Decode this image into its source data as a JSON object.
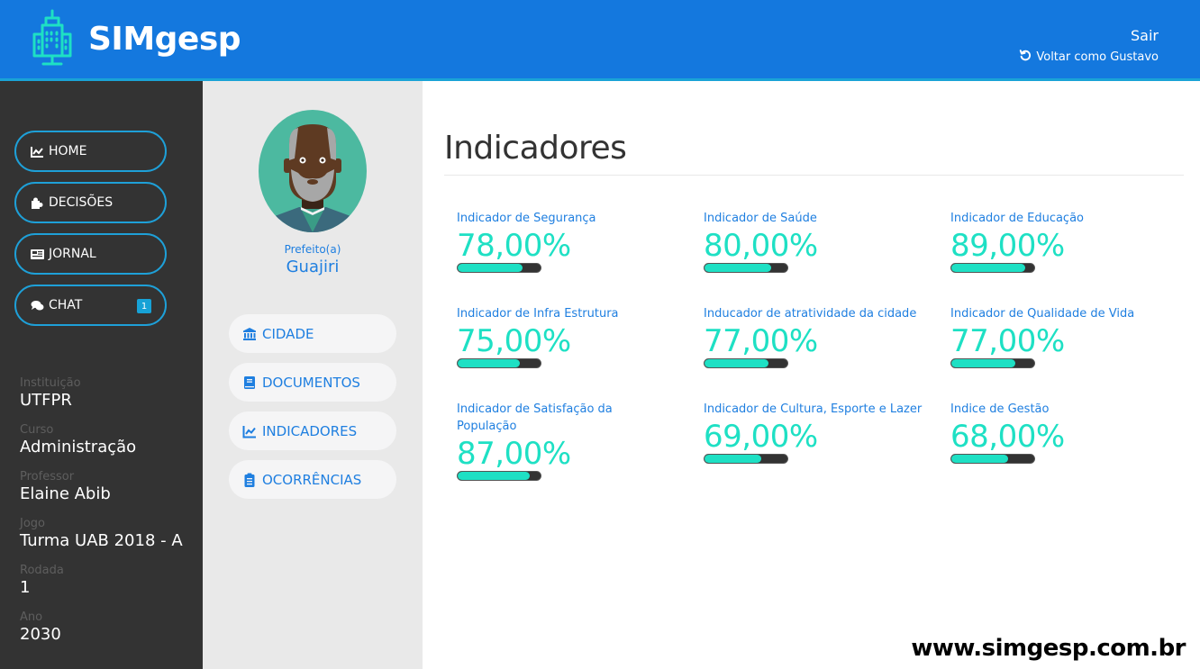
{
  "app": {
    "name": "SIMgesp",
    "logo_icon": "city-monitor-icon"
  },
  "header": {
    "logout_label": "Sair",
    "return_label": "Voltar como Gustavo",
    "return_icon": "undo-icon"
  },
  "sidebar": {
    "nav": [
      {
        "label": "HOME",
        "icon": "line-chart-icon"
      },
      {
        "label": "DECISÕES",
        "icon": "puzzle-icon"
      },
      {
        "label": "JORNAL",
        "icon": "newspaper-icon"
      },
      {
        "label": "CHAT",
        "icon": "comments-icon",
        "badge": "1"
      }
    ],
    "info": [
      {
        "label": "Instituição",
        "value": "UTFPR"
      },
      {
        "label": "Curso",
        "value": "Administração"
      },
      {
        "label": "Professor",
        "value": "Elaine Abib"
      },
      {
        "label": "Jogo",
        "value": "Turma UAB 2018 - A"
      },
      {
        "label": "Rodada",
        "value": "1"
      },
      {
        "label": "Ano",
        "value": "2030"
      }
    ]
  },
  "profile": {
    "role": "Prefeito(a)",
    "name": "Guajiri",
    "menu": [
      {
        "label": "CIDADE",
        "icon": "bank-icon"
      },
      {
        "label": "DOCUMENTOS",
        "icon": "book-icon"
      },
      {
        "label": "INDICADORES",
        "icon": "line-chart-icon"
      },
      {
        "label": "OCORRÊNCIAS",
        "icon": "clipboard-icon"
      }
    ]
  },
  "main": {
    "title": "Indicadores",
    "indicators": [
      {
        "label": "Indicador de Segurança",
        "value_text": "78,00%",
        "percent": 78
      },
      {
        "label": "Indicador de Saúde",
        "value_text": "80,00%",
        "percent": 80
      },
      {
        "label": "Indicador de Educação",
        "value_text": "89,00%",
        "percent": 89
      },
      {
        "label": "Indicador de Infra Estrutura",
        "value_text": "75,00%",
        "percent": 75
      },
      {
        "label": "Inducador de atratividade da cidade",
        "value_text": "77,00%",
        "percent": 77
      },
      {
        "label": "Indicador de Qualidade de Vida",
        "value_text": "77,00%",
        "percent": 77
      },
      {
        "label": "Indicador de Satisfação da População",
        "value_text": "87,00%",
        "percent": 87
      },
      {
        "label": "Indicador de Cultura, Esporte e Lazer",
        "value_text": "69,00%",
        "percent": 69
      },
      {
        "label": "Indice de Gestão",
        "value_text": "68,00%",
        "percent": 68
      }
    ]
  },
  "watermark": "www.simgesp.com.br",
  "colors": {
    "header": "#1478de",
    "accent_teal": "#1ee0c4",
    "link_blue": "#1f7fe0",
    "sidebar_bg": "#333333",
    "nav_border": "#1ea0d8"
  }
}
